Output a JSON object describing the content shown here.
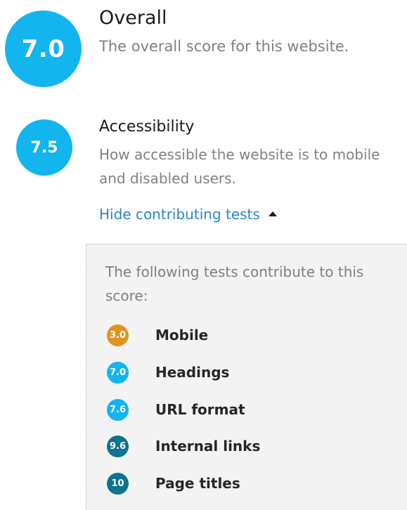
{
  "overall": {
    "score": "7.0",
    "title": "Overall",
    "description": "The overall score for this website.",
    "color": "#12b5ee"
  },
  "accessibility": {
    "score": "7.5",
    "title": "Accessibility",
    "description": "How accessible the website is to mobile and disabled users.",
    "color": "#12b5ee",
    "toggle_label": "Hide contributing tests",
    "toggle_icon": "caret-up-icon"
  },
  "tests_panel": {
    "intro": "The following tests contribute to this score:",
    "tests": [
      {
        "score": "3.0",
        "name": "Mobile",
        "color": "#e0941f"
      },
      {
        "score": "7.0",
        "name": "Headings",
        "color": "#12b5ee"
      },
      {
        "score": "7.6",
        "name": "URL format",
        "color": "#12b5ee"
      },
      {
        "score": "9.6",
        "name": "Internal links",
        "color": "#0d7391"
      },
      {
        "score": "10",
        "name": "Page titles",
        "color": "#0d7391"
      }
    ]
  }
}
